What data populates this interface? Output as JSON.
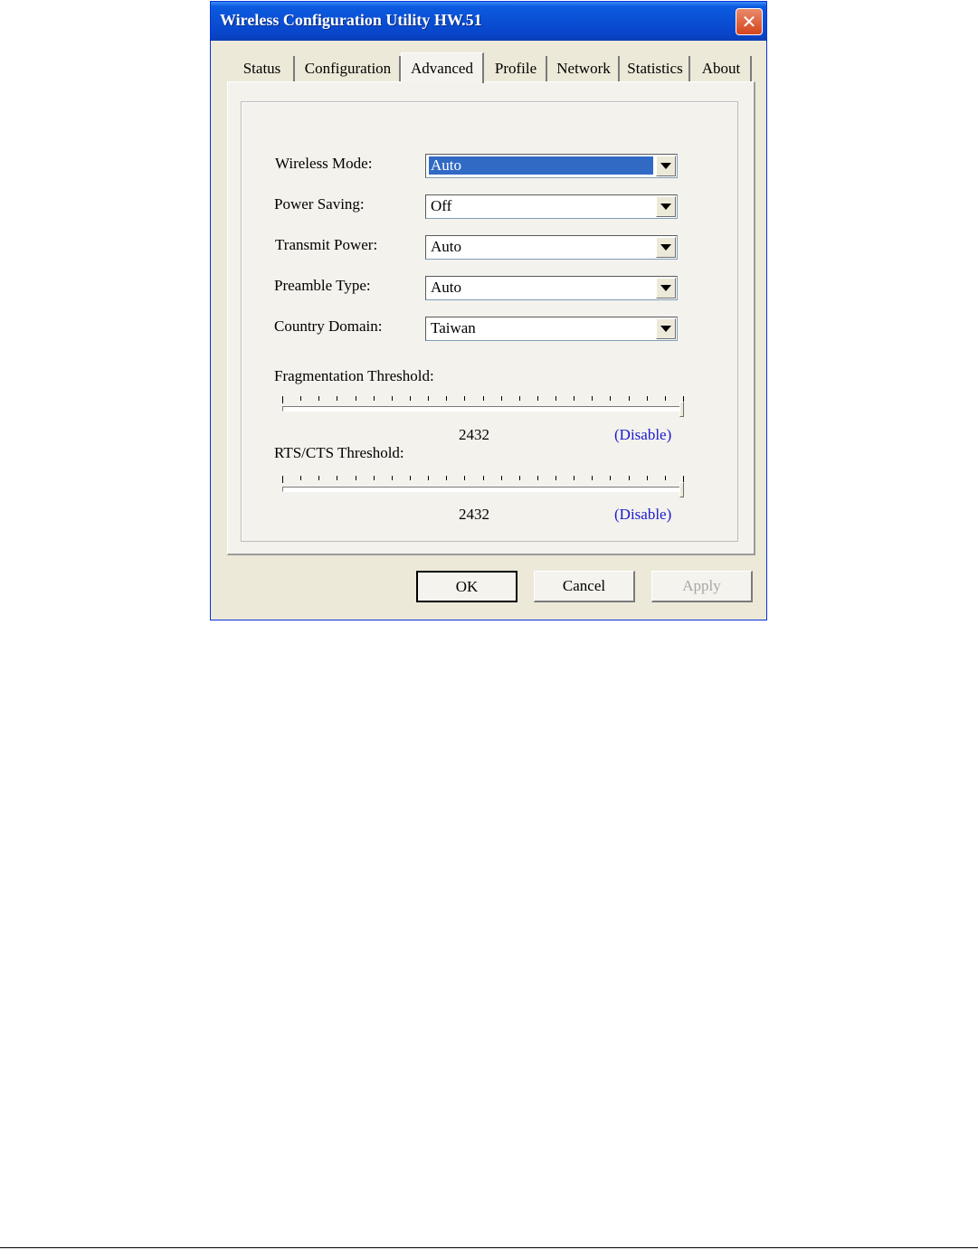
{
  "window": {
    "title": "Wireless Configuration Utility HW.51",
    "close_glyph": "✕"
  },
  "tabs": [
    {
      "label": "Status",
      "active": false
    },
    {
      "label": "Configuration",
      "active": false
    },
    {
      "label": "Advanced",
      "active": true
    },
    {
      "label": "Profile",
      "active": false
    },
    {
      "label": "Network",
      "active": false
    },
    {
      "label": "Statistics",
      "active": false
    },
    {
      "label": "About",
      "active": false
    }
  ],
  "advanced": {
    "wireless_mode": {
      "label": "Wireless Mode:",
      "value": "Auto",
      "focused": true
    },
    "power_saving": {
      "label": "Power Saving:",
      "value": "Off"
    },
    "transmit_power": {
      "label": "Transmit Power:",
      "value": "Auto"
    },
    "preamble_type": {
      "label": "Preamble Type:",
      "value": "Auto"
    },
    "country_domain": {
      "label": "Country Domain:",
      "value": "Taiwan"
    },
    "fragmentation": {
      "label": "Fragmentation Threshold:",
      "value": "2432",
      "status": "(Disable)",
      "slider_fraction": 1.0
    },
    "rts_cts": {
      "label": "RTS/CTS Threshold:",
      "value": "2432",
      "status": "(Disable)",
      "slider_fraction": 1.0
    }
  },
  "buttons": {
    "ok": "OK",
    "cancel": "Cancel",
    "apply": "Apply"
  },
  "colors": {
    "titlebar": "#0a4fd4",
    "selection": "#316ac5",
    "link_blue": "#1a1ad0",
    "face": "#ece9d8"
  },
  "icons": {
    "close": "close-icon",
    "dropdown": "chevron-down-icon"
  }
}
